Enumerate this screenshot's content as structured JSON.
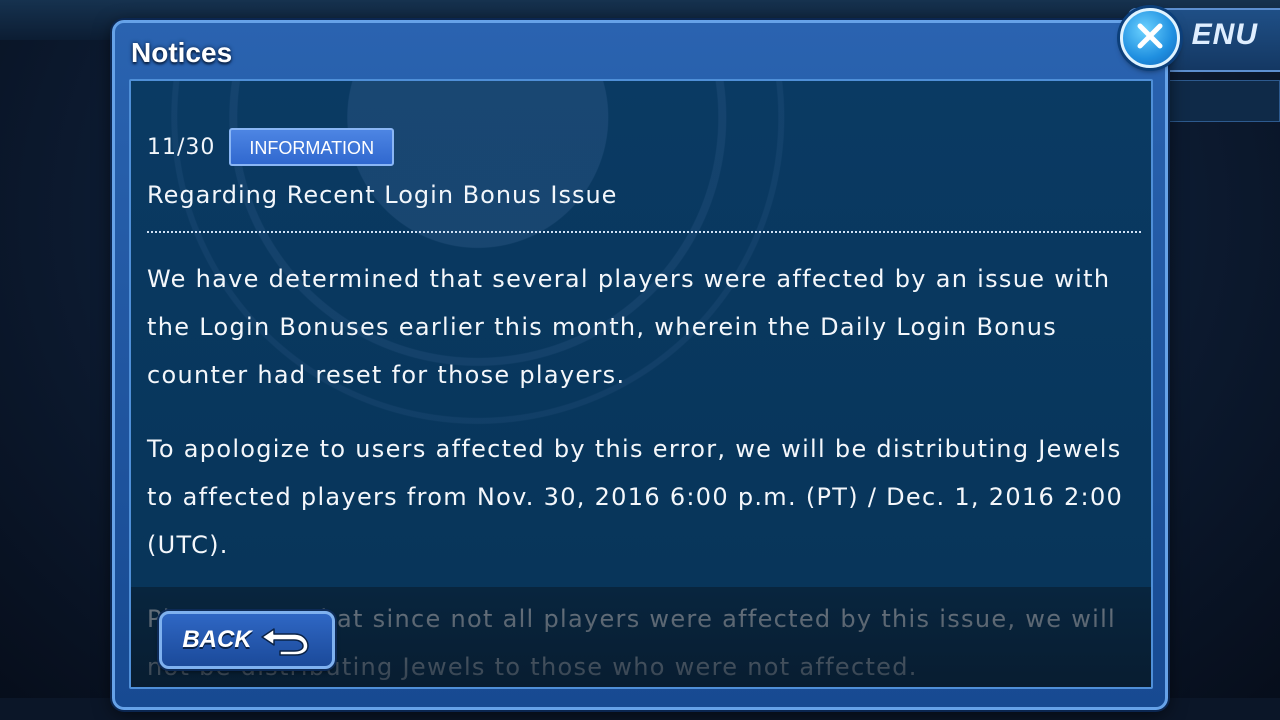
{
  "modal": {
    "title": "Notices",
    "close_icon": "close-icon"
  },
  "notice": {
    "date": "11/30",
    "category": "INFORMATION",
    "headline": "Regarding Recent Login Bonus Issue",
    "paragraphs": [
      "We have determined that several players were affected by an issue with the Login Bonuses earlier this month, wherein the Daily Login Bonus counter had reset for those players.",
      "To apologize to users affected by this error, we will be distributing Jewels to affected players from Nov. 30, 2016 6:00 p.m. (PT) / Dec. 1, 2016 2:00 (UTC).",
      "Please note that since not all players were affected by this issue, we will not be distributing Jewels to those who were not affected."
    ]
  },
  "footer": {
    "back_label": "BACK",
    "back_icon": "return-arrow-icon"
  },
  "background": {
    "menu_label": "ENU"
  },
  "colors": {
    "modal_frame": "#2a63b0",
    "content_bg": "#0a3a63",
    "badge_bg": "#4d85e3",
    "close_button": "#1f8fe0"
  }
}
